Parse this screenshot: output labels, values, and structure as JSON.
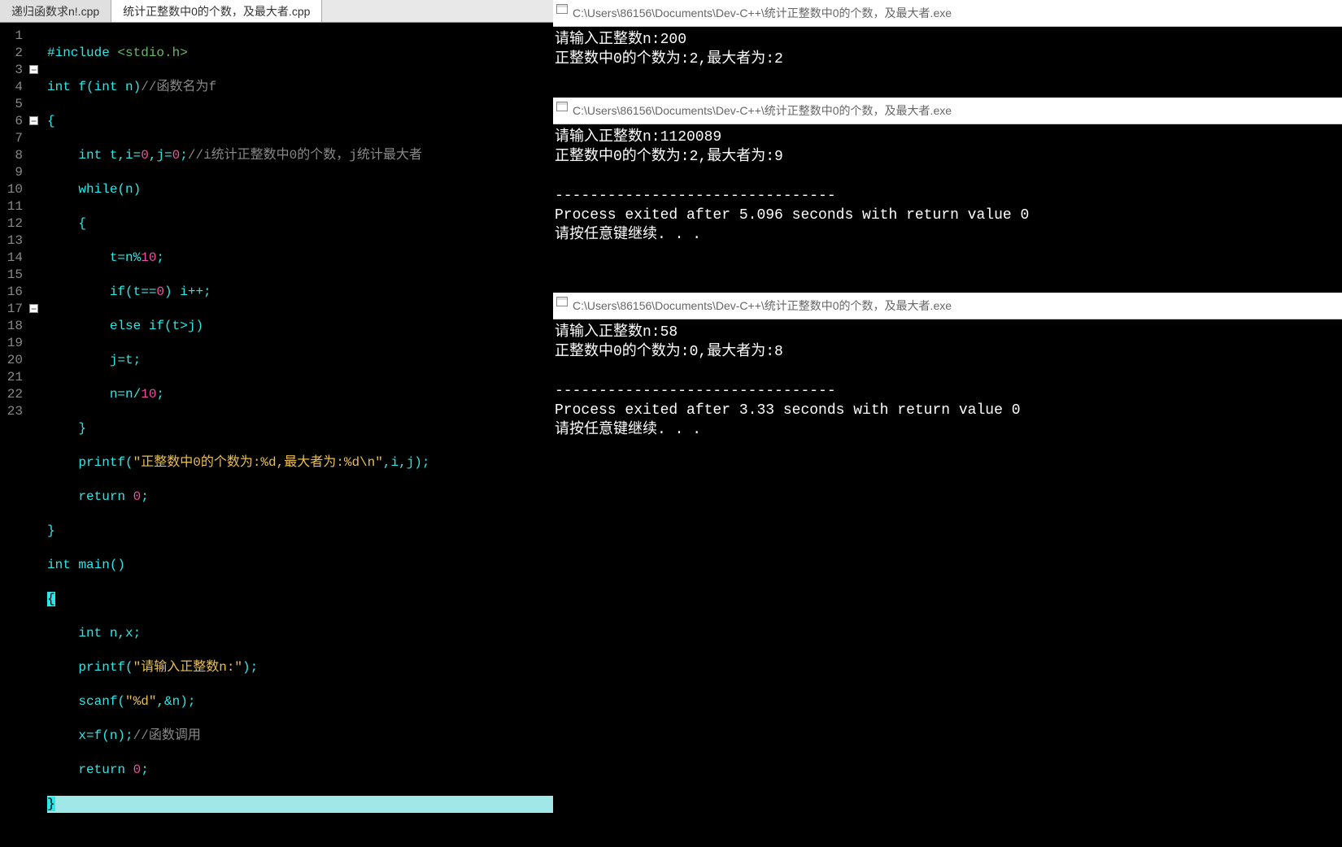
{
  "tabs": [
    {
      "label": "递归函数求n!.cpp",
      "active": false
    },
    {
      "label": "统计正整数中0的个数，及最大者.cpp",
      "active": true
    }
  ],
  "code": {
    "l1": {
      "include_kw": "#include",
      "path": " <stdio.h>"
    },
    "l2": {
      "a": "int",
      "b": " f(",
      "c": "int",
      "d": " n)",
      "cm": "//函数名为f"
    },
    "l3": "{",
    "l4": {
      "a": "    int",
      "b": " t,i=",
      "n1": "0",
      "c": ",j=",
      "n2": "0",
      "d": ";",
      "cm": "//i统计正整数中0的个数，j统计最大者"
    },
    "l5": {
      "a": "    while",
      "b": "(n)"
    },
    "l6": "    {",
    "l7": {
      "a": "        t=n%",
      "n": "10",
      "b": ";"
    },
    "l8": {
      "a": "        if",
      "b": "(t==",
      "n": "0",
      "c": ") i++;"
    },
    "l9": {
      "a": "        else if",
      "b": "(t>j)"
    },
    "l10": "        j=t;",
    "l11": {
      "a": "        n=n/",
      "n": "10",
      "b": ";"
    },
    "l12": "    }",
    "l13": {
      "a": "    printf(",
      "s": "\"正整数中0的个数为:%d,最大者为:%d\\n\"",
      "b": ",i,j);"
    },
    "l14": {
      "a": "    return ",
      "n": "0",
      "b": ";"
    },
    "l15": "}",
    "l16": {
      "a": "int",
      "b": " main()"
    },
    "l17": "{",
    "l18": {
      "a": "    int",
      "b": " n,x;"
    },
    "l19": {
      "a": "    printf(",
      "s": "\"请输入正整数n:\"",
      "b": ");"
    },
    "l20": {
      "a": "    scanf(",
      "s": "\"%d\"",
      "b": ",&n);"
    },
    "l21": {
      "a": "    x=f(n);",
      "cm": "//函数调用"
    },
    "l22": {
      "a": "    return ",
      "n": "0",
      "b": ";"
    },
    "l23": "}"
  },
  "consoles": [
    {
      "title": "C:\\Users\\86156\\Documents\\Dev-C++\\统计正整数中0的个数，及最大者.exe",
      "body": "请输入正整数n:200\n正整数中0的个数为:2,最大者为:2"
    },
    {
      "title": "C:\\Users\\86156\\Documents\\Dev-C++\\统计正整数中0的个数，及最大者.exe",
      "body": "请输入正整数n:1120089\n正整数中0的个数为:2,最大者为:9\n\n--------------------------------\nProcess exited after 5.096 seconds with return value 0\n请按任意键继续. . ."
    },
    {
      "title": "C:\\Users\\86156\\Documents\\Dev-C++\\统计正整数中0的个数，及最大者.exe",
      "body": "请输入正整数n:58\n正整数中0的个数为:0,最大者为:8\n\n--------------------------------\nProcess exited after 3.33 seconds with return value 0\n请按任意键继续. . ."
    }
  ]
}
